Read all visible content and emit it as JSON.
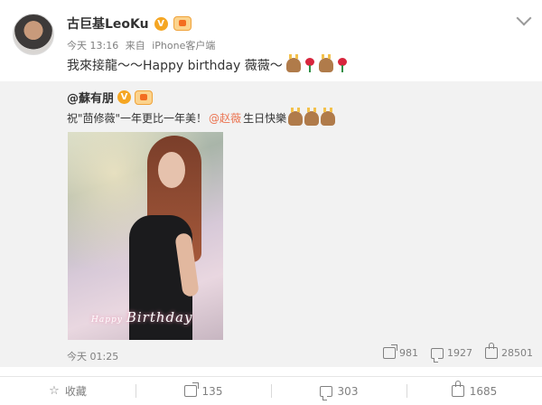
{
  "post": {
    "author": "古巨基LeoKu",
    "badge": "V",
    "time": "今天 13:16",
    "source_prefix": "来自",
    "source": "iPhone客户端",
    "text": "我來接龍～～Happy birthday 薇薇～"
  },
  "repost": {
    "author": "@蘇有朋",
    "badge": "V",
    "text_before": "祝\"茴修薇\"一年更比一年美！",
    "mention": "@赵薇",
    "text_after": "生日快樂",
    "photo_caption_small": "Happy",
    "photo_caption": "Birthday",
    "time": "今天 01:25",
    "stats": {
      "reposts": "981",
      "comments": "1927",
      "likes": "28501"
    }
  },
  "actions": {
    "favorite": "收藏",
    "repost": "135",
    "comment": "303",
    "like": "1685"
  },
  "icons": [
    "chevron-down-icon",
    "star-icon",
    "share-icon",
    "comment-icon",
    "like-icon"
  ],
  "colors": {
    "mention": "#eb7350",
    "repost_bg": "#f2f2f2",
    "meta_text": "#808080"
  }
}
